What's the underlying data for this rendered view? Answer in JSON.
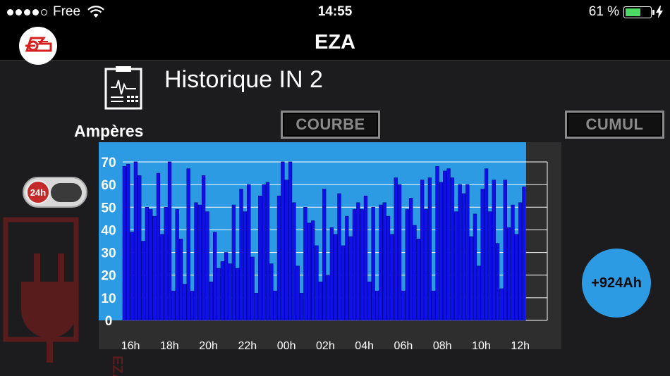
{
  "status_bar": {
    "carrier": "Free",
    "time": "14:55",
    "battery_percent": "61 %",
    "battery_level": 0.61
  },
  "nav": {
    "title": "EZA"
  },
  "header": {
    "title": "Historique IN 2",
    "unit_label": "Ampères"
  },
  "buttons": {
    "courbe": "COURBE",
    "cumul": "CUMUL"
  },
  "toggle": {
    "label": "24h",
    "state": "off"
  },
  "total": {
    "value": "+924Ah"
  },
  "watermark_text": "EZA",
  "colors": {
    "plot_bg": "#2d9be3",
    "bar": "#1010ee",
    "bar_border": "#000080",
    "grid": "#ffffff",
    "axis_panel": "#2e2e2e",
    "toggle_knob": "#c42a2a",
    "badge": "#2d9be3",
    "logo_red": "#d62020",
    "watermark_red": "#8a1c1c"
  },
  "chart_data": {
    "type": "bar",
    "ylim": [
      0,
      70
    ],
    "yticks": [
      "0",
      "10",
      "20",
      "30",
      "40",
      "50",
      "60",
      "70"
    ],
    "xticks": [
      "16h",
      "18h",
      "20h",
      "22h",
      "00h",
      "02h",
      "04h",
      "06h",
      "08h",
      "10h",
      "12h"
    ],
    "x_range_hours": [
      15.6,
      36.3
    ],
    "x_first_tick_hour": 16,
    "series": [
      {
        "values": [
          68,
          69,
          39,
          70,
          64,
          35,
          50,
          49,
          46,
          65,
          38,
          50,
          70,
          13,
          49,
          36,
          16,
          67,
          13,
          52,
          51,
          64,
          48,
          17,
          39,
          23,
          26,
          30,
          25,
          51,
          23,
          58,
          48,
          60,
          28,
          12,
          55,
          60,
          61,
          25,
          13,
          55,
          70,
          62,
          70,
          52,
          24,
          12,
          50,
          43,
          44,
          33,
          17,
          58,
          20,
          41,
          38,
          56,
          33,
          46,
          37,
          49,
          52,
          49,
          55,
          17,
          50,
          13,
          51,
          52,
          46,
          38,
          63,
          60,
          13,
          49,
          54,
          42,
          36,
          62,
          49,
          63,
          13,
          68,
          61,
          66,
          67,
          63,
          48,
          60,
          56,
          60,
          37,
          47,
          24,
          58,
          67,
          48,
          62,
          34,
          14,
          62,
          41,
          51,
          38,
          52,
          59
        ]
      }
    ]
  }
}
